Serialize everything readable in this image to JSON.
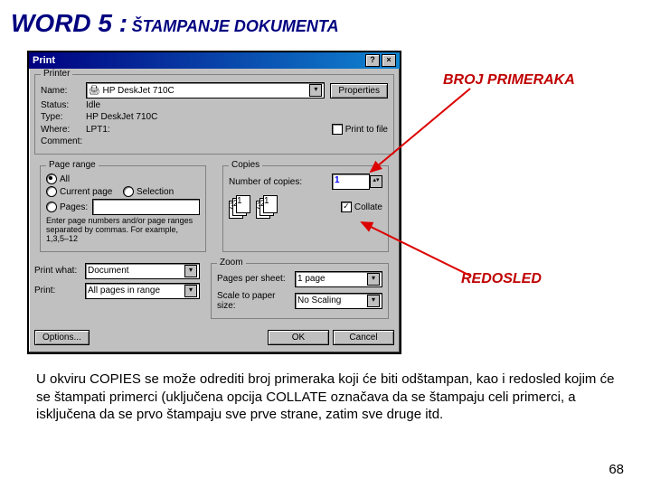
{
  "header": {
    "word": "WORD 5 :",
    "title": "ŠTAMPANJE DOKUMENTA"
  },
  "dialog": {
    "title": "Print",
    "printer": {
      "group": "Printer",
      "name_l": "Name:",
      "name_v": "HP DeskJet 710C",
      "status_l": "Status:",
      "status_v": "Idle",
      "type_l": "Type:",
      "type_v": "HP DeskJet 710C",
      "where_l": "Where:",
      "where_v": "LPT1:",
      "comment_l": "Comment:",
      "props": "Properties",
      "ptf": "Print to file"
    },
    "range": {
      "group": "Page range",
      "all": "All",
      "cur": "Current page",
      "sel": "Selection",
      "pages": "Pages:",
      "hint": "Enter page numbers and/or page ranges separated by commas. For example, 1,3,5–12"
    },
    "copies": {
      "group": "Copies",
      "num_l": "Number of copies:",
      "num_v": "1",
      "collate": "Collate"
    },
    "zoom": {
      "group": "Zoom",
      "pps_l": "Pages per sheet:",
      "pps_v": "1 page",
      "scale_l": "Scale to paper size:",
      "scale_v": "No Scaling"
    },
    "pw": {
      "l": "Print what:",
      "v": "Document"
    },
    "pr": {
      "l": "Print:",
      "v": "All pages in range"
    },
    "opt": "Options...",
    "ok": "OK",
    "cancel": "Cancel"
  },
  "ann": {
    "a1": "BROJ PRIMERAKA",
    "a2": "REDOSLED"
  },
  "para": "U okviru COPIES se može odrediti broj primeraka koji će biti odštampan, kao i redosled kojim će se štampati primerci (uključena opcija COLLATE označava da se štampaju celi primerci, a isključena da se prvo štampaju sve prve strane, zatim sve druge itd.",
  "page": "68"
}
